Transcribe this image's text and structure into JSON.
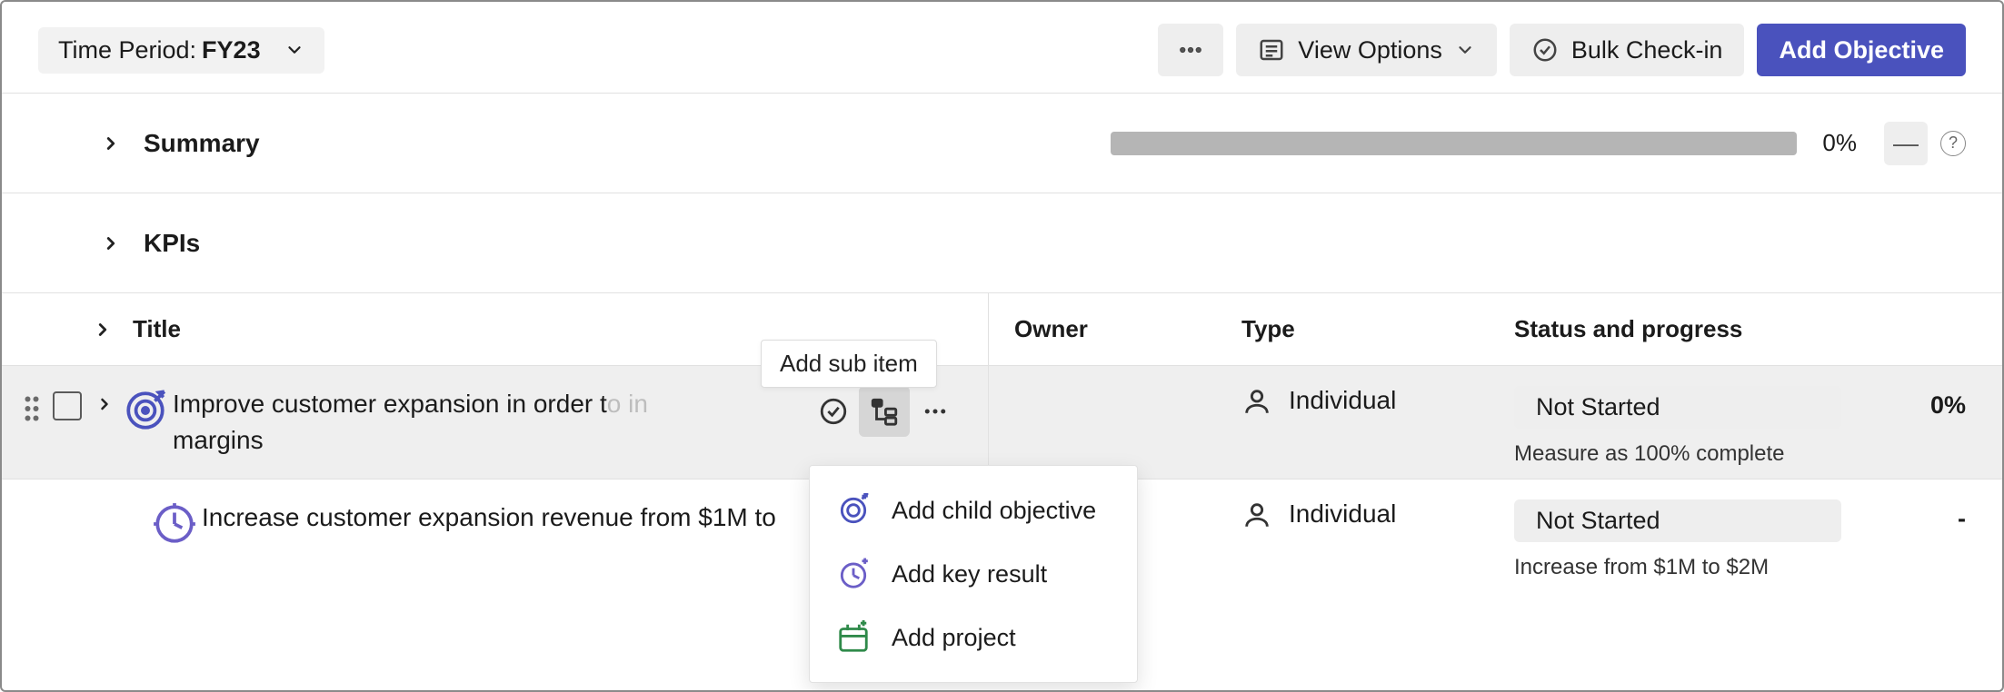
{
  "toolbar": {
    "time_period_label": "Time Period:",
    "time_period_value": "FY23",
    "view_options_label": "View Options",
    "bulk_checkin_label": "Bulk Check-in",
    "add_objective_label": "Add Objective"
  },
  "sections": {
    "summary": {
      "title": "Summary",
      "progress_pct": "0%",
      "collapse_glyph": "—"
    },
    "kpis": {
      "title": "KPIs"
    }
  },
  "columns": {
    "title": "Title",
    "owner": "Owner",
    "type": "Type",
    "status": "Status and progress"
  },
  "rows": [
    {
      "title_visible": "Improve customer expansion in order to in",
      "title_faded_tail": "o in",
      "title_line2": "margins",
      "type": "Individual",
      "status": "Not Started",
      "status_sub": "Measure as 100% complete",
      "progress_pct": "0%"
    },
    {
      "title_visible": "Increase customer expansion revenue from $1M to",
      "trailing_ellipsis": "...",
      "type": "Individual",
      "status": "Not Started",
      "status_sub": "Increase from $1M to $2M",
      "progress_pct": "-"
    }
  ],
  "tooltip": {
    "add_sub_item": "Add sub item"
  },
  "menu": {
    "add_child_objective": "Add child objective",
    "add_key_result": "Add key result",
    "add_project": "Add project"
  }
}
